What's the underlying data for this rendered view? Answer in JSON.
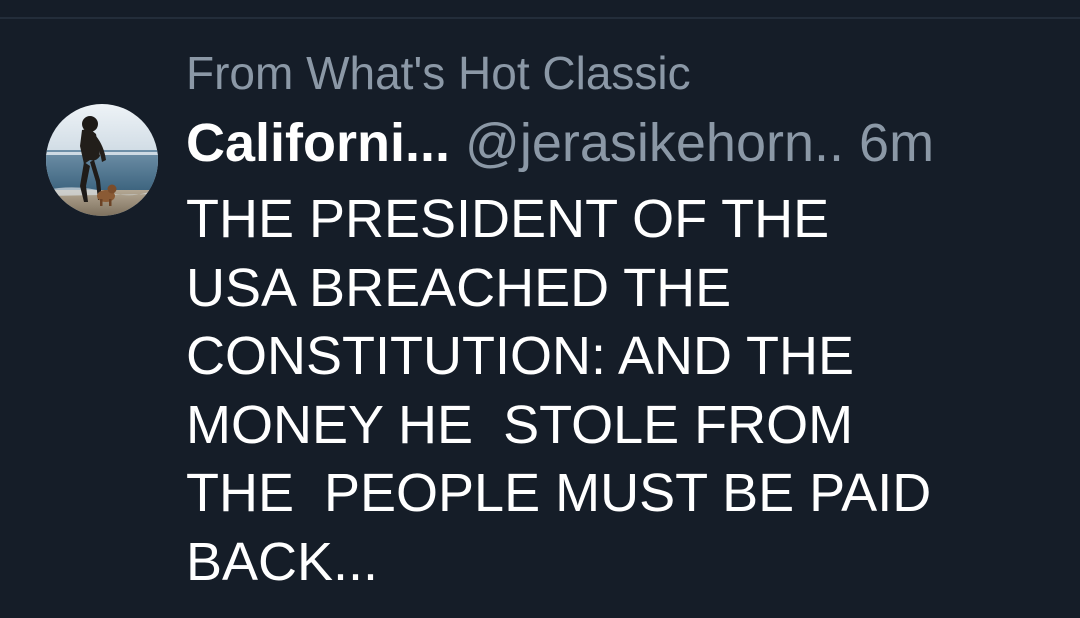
{
  "context": {
    "label": "From What's Hot Classic"
  },
  "tweet": {
    "display_name": "Californi...",
    "handle": "@jerasikehorn..",
    "timestamp": "6m",
    "text": "THE PRESIDENT OF THE\nUSA BREACHED THE\nCONSTITUTION: AND THE\nMONEY HE  STOLE FROM\nTHE  PEOPLE MUST BE PAID\nBACK...",
    "avatar_description": "avatar-photo"
  },
  "colors": {
    "background": "#151d28",
    "primary_text": "#ffffff",
    "secondary_text": "#8b98a6"
  }
}
